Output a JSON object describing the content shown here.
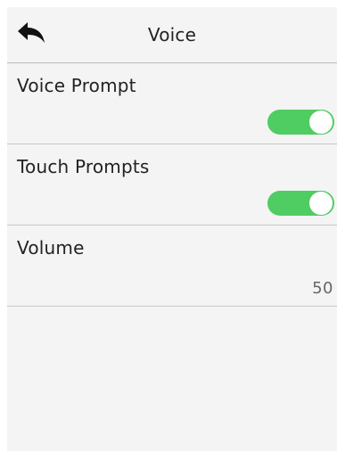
{
  "header": {
    "title": "Voice"
  },
  "settings": {
    "voice_prompt": {
      "label": "Voice Prompt",
      "state": "on"
    },
    "touch_prompts": {
      "label": "Touch Prompts",
      "state": "on"
    },
    "volume": {
      "label": "Volume",
      "value": "50"
    }
  },
  "colors": {
    "toggle_on": "#4fcc62",
    "background": "#f4f4f4",
    "divider": "#c8c8c8"
  },
  "icons": {
    "back": "back-arrow-icon"
  }
}
